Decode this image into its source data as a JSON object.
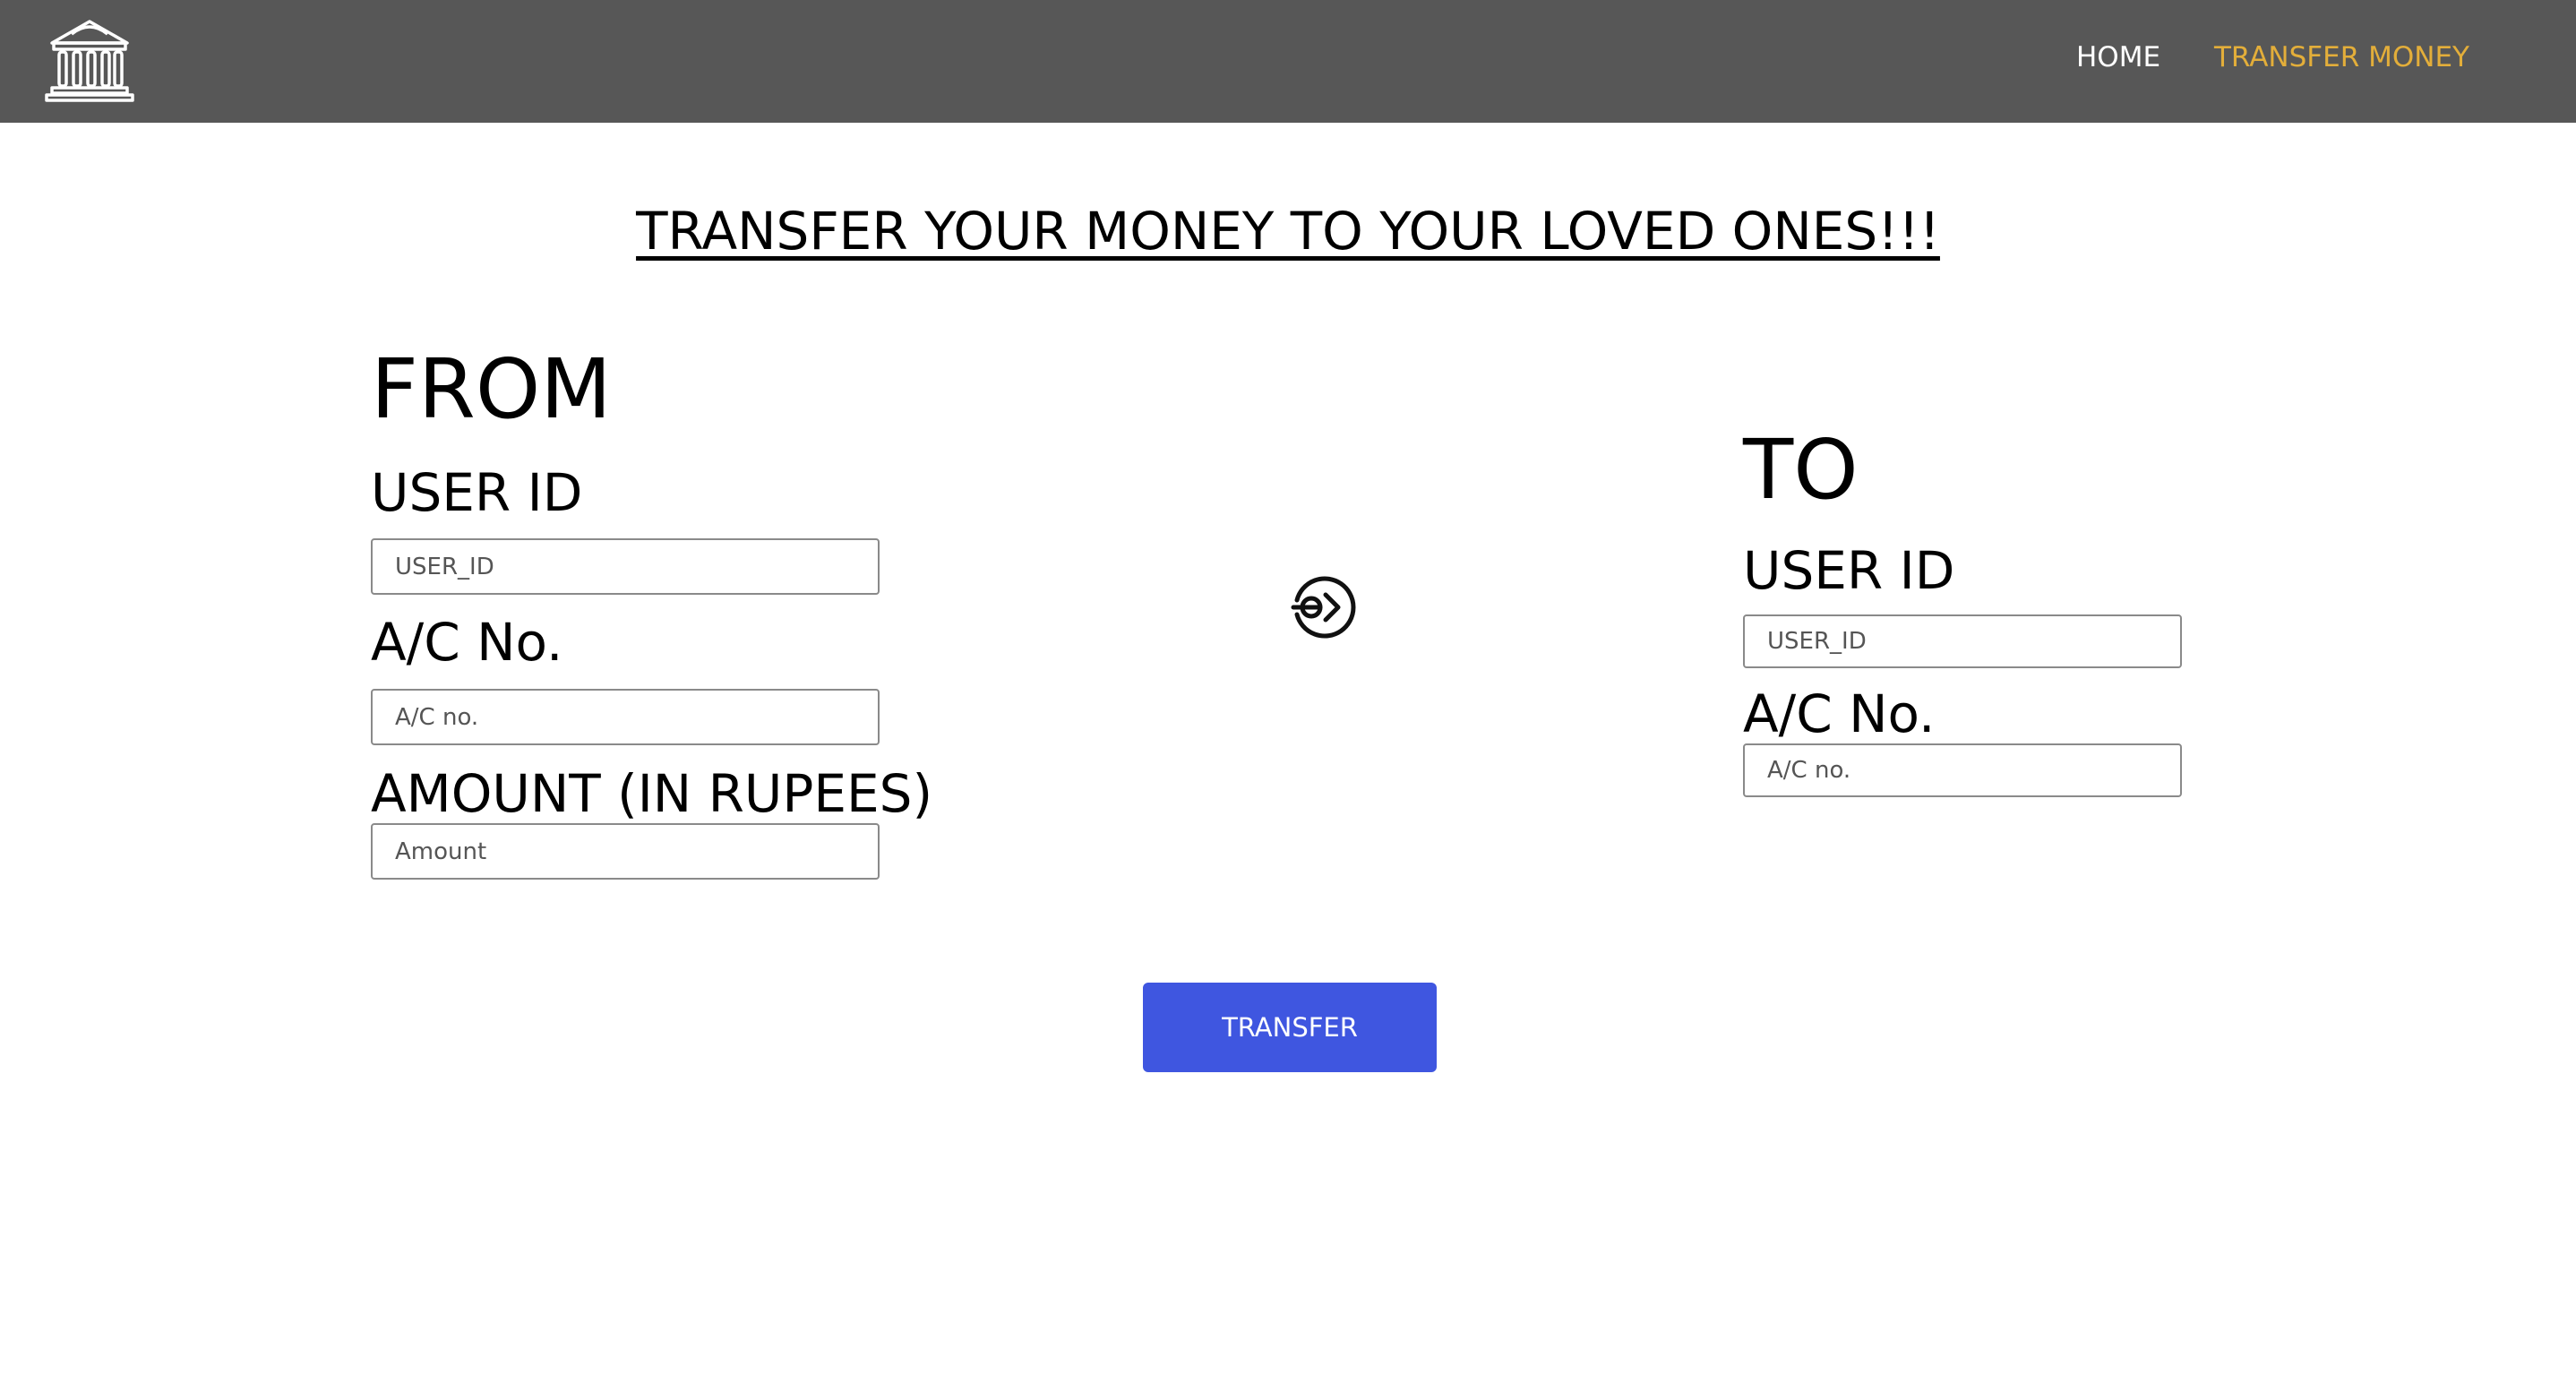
{
  "nav": {
    "logo_icon": "bank-building-icon",
    "home_label": "HOME",
    "transfer_label": "TRANSFER MONEY",
    "active_color": "#e3ae3a",
    "bar_color": "#575757"
  },
  "page": {
    "heading": "TRANSFER YOUR MONEY TO YOUR LOVED ONES!!!"
  },
  "from": {
    "title": "FROM",
    "user_id_label": "USER ID",
    "user_id_placeholder": "USER_ID",
    "ac_label": "A/C No.",
    "ac_placeholder": "A/C no.",
    "amount_label": "AMOUNT (IN RUPEES)",
    "amount_placeholder": "Amount"
  },
  "to": {
    "title": "TO",
    "user_id_label": "USER ID",
    "user_id_placeholder": "USER_ID",
    "ac_label": "A/C No.",
    "ac_placeholder": "A/C no."
  },
  "direction_icon": "circle-arrow-right-icon",
  "actions": {
    "transfer_label": "TRANSFER",
    "button_color": "#3f56e0"
  }
}
